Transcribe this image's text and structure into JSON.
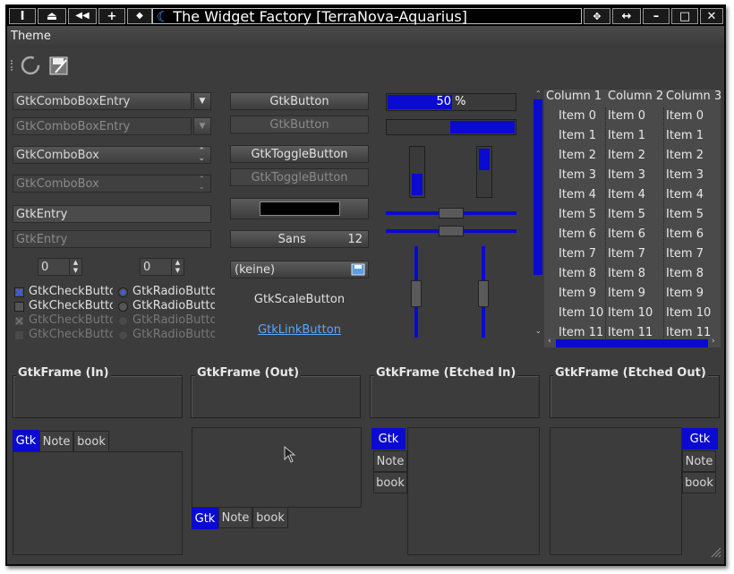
{
  "window": {
    "title": "The Widget Factory [TerraNova-Aquarius]",
    "left_buttons": [
      "I",
      "⏏",
      "◀◀",
      "+",
      "◆"
    ],
    "right_buttons": [
      "✥",
      "↔",
      "–",
      "□",
      "✕"
    ]
  },
  "menu": {
    "items": [
      "Theme"
    ]
  },
  "toolbar": {
    "icons": [
      "refresh-icon",
      "save-as-icon"
    ]
  },
  "combos": {
    "entry1": "GtkComboBoxEntry",
    "entry2": "GtkComboBoxEntry",
    "box1": "GtkComboBox",
    "box2": "GtkComboBox"
  },
  "entries": {
    "entry1": "GtkEntry",
    "entry2": "GtkEntry"
  },
  "spins": {
    "spin1": "0",
    "spin2": "0"
  },
  "checks": [
    {
      "label": "GtkCheckButton",
      "checked": true,
      "disabled": false
    },
    {
      "label": "GtkCheckButton",
      "checked": false,
      "disabled": false
    },
    {
      "label": "GtkCheckButton",
      "checked": true,
      "disabled": true
    },
    {
      "label": "GtkCheckButton",
      "checked": false,
      "disabled": true
    }
  ],
  "radios": [
    {
      "label": "GtkRadioButton",
      "checked": true,
      "disabled": false
    },
    {
      "label": "GtkRadioButton",
      "checked": false,
      "disabled": false
    },
    {
      "label": "GtkRadioButton",
      "checked": false,
      "disabled": true
    },
    {
      "label": "GtkRadioButton",
      "checked": false,
      "disabled": true
    }
  ],
  "buttons": {
    "button": "GtkButton",
    "button_dis": "GtkButton",
    "toggle": "GtkToggleButton",
    "toggle_dis": "GtkToggleButton",
    "font_name": "Sans",
    "font_size": "12",
    "file": "(keine)",
    "scale_button": "GtkScaleButton",
    "link_button": "GtkLinkButton"
  },
  "progress": {
    "label": "50 %",
    "value": 0.5,
    "value2": 0.5
  },
  "tree": {
    "columns": [
      "Column 1",
      "Column 2",
      "Column 3"
    ],
    "rows": [
      "Item 0",
      "Item 1",
      "Item 2",
      "Item 3",
      "Item 4",
      "Item 5",
      "Item 6",
      "Item 7",
      "Item 8",
      "Item 9",
      "Item 10",
      "Item 11"
    ]
  },
  "frames": [
    "GtkFrame (In)",
    "GtkFrame (Out)",
    "GtkFrame (Etched In)",
    "GtkFrame (Etched Out)"
  ],
  "notebook_tabs": [
    "Gtk",
    "Note",
    "book"
  ],
  "colors": {
    "accent": "#0a0ad0",
    "window_bg": "#3c3c3c"
  }
}
